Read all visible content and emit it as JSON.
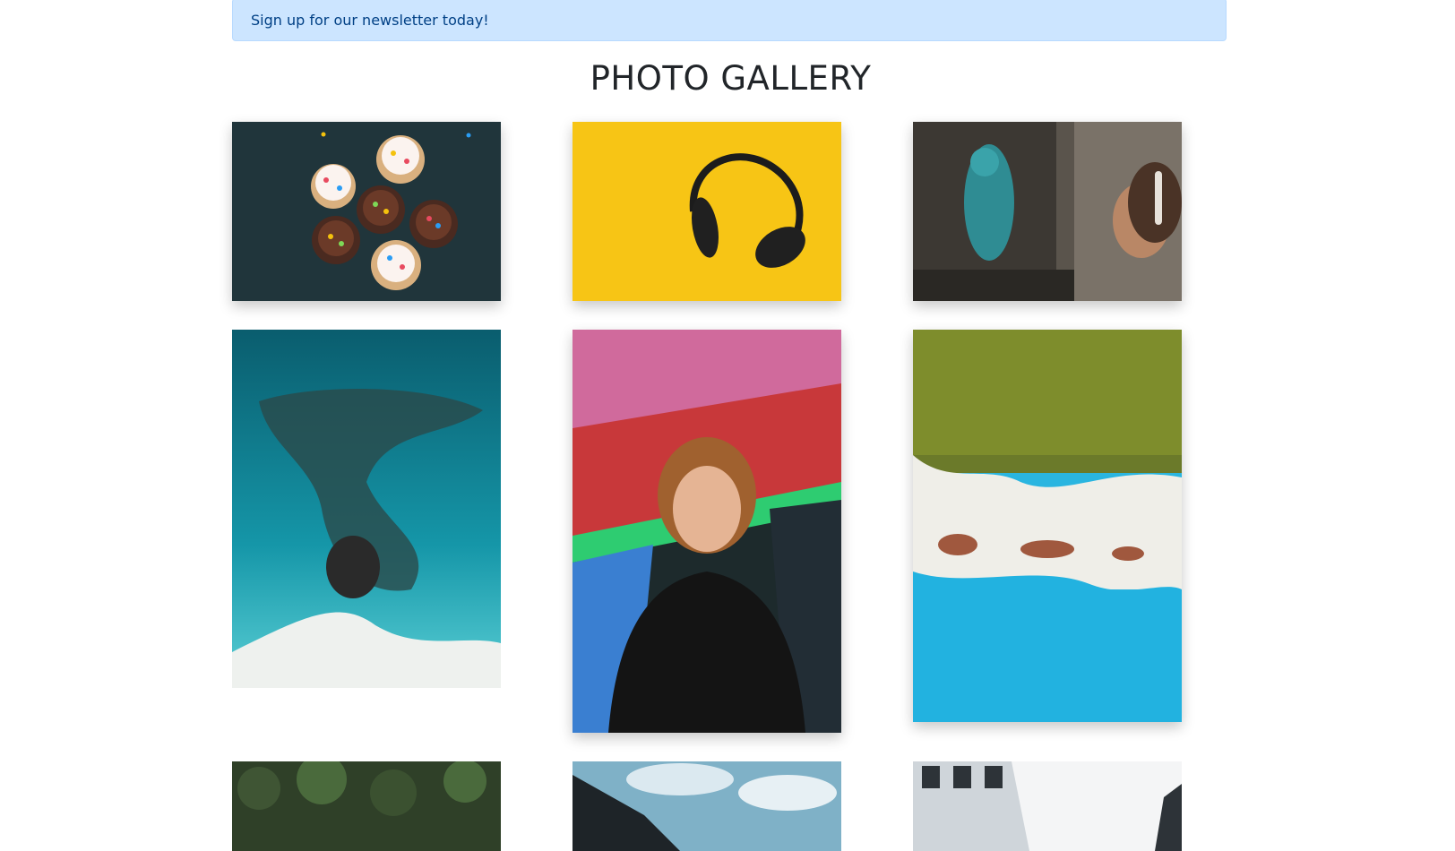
{
  "banner": {
    "text": "Sign up for our newsletter today!"
  },
  "gallery": {
    "title": "PHOTO GALLERY",
    "photos": [
      {
        "subject": "cupcakes"
      },
      {
        "subject": "headphones"
      },
      {
        "subject": "graffiti-woman"
      },
      {
        "subject": "ocean-aerial"
      },
      {
        "subject": "portrait-graffiti"
      },
      {
        "subject": "beach-aerial"
      },
      {
        "subject": "palm-trees"
      },
      {
        "subject": "building-sky"
      },
      {
        "subject": "building-facade"
      }
    ]
  },
  "colors": {
    "banner_bg": "#cce5ff",
    "banner_text": "#004085",
    "title": "#212529"
  }
}
